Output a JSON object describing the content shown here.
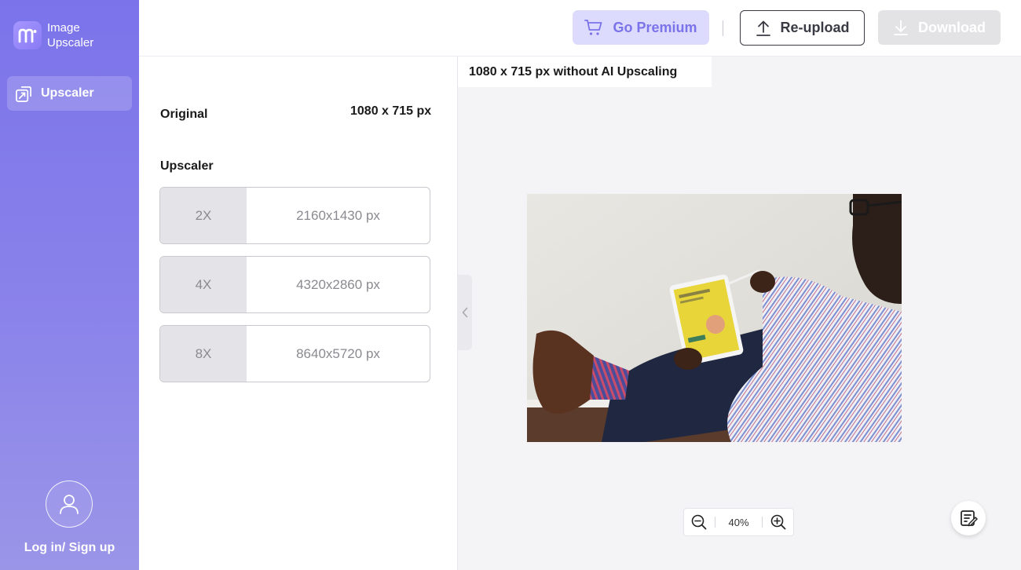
{
  "brand": {
    "line1": "Image",
    "line2": "Upscaler",
    "logo_letter": "m"
  },
  "nav": {
    "upscaler_label": "Upscaler"
  },
  "account": {
    "login_label": "Log in/ Sign up"
  },
  "toolbar": {
    "premium_label": "Go Premium",
    "reupload_label": "Re-upload",
    "download_label": "Download",
    "separator": "|"
  },
  "panel": {
    "original_label": "Original",
    "original_value": "1080 x 715 px",
    "upscaler_label": "Upscaler",
    "options": [
      {
        "scale": "2X",
        "resolution": "2160x1430 px"
      },
      {
        "scale": "4X",
        "resolution": "4320x2860 px"
      },
      {
        "scale": "8X",
        "resolution": "8640x5720 px"
      }
    ]
  },
  "preview": {
    "caption": "1080 x 715 px without AI Upscaling",
    "zoom_level": "40%"
  },
  "colors": {
    "accent": "#7b73ea",
    "premium_bg": "#dcdafd",
    "download_disabled": "#e3e3e6",
    "sidebar_top": "#7b73ea",
    "sidebar_bottom": "#9b95e8"
  },
  "icons": {
    "logo": "brand-logo-icon",
    "nav": "upscale-icon",
    "premium": "cart-icon",
    "reupload": "upload-icon",
    "download": "download-icon",
    "avatar": "user-icon",
    "collapse": "chevron-left-icon",
    "zoom_out": "zoom-out-icon",
    "zoom_in": "zoom-in-icon",
    "feedback": "feedback-icon"
  }
}
